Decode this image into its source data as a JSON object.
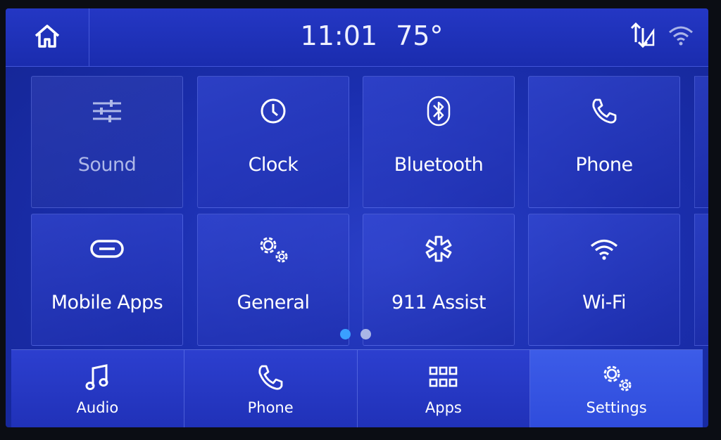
{
  "status_bar": {
    "time": "11:01",
    "temperature": "75°",
    "icons": [
      "home-icon",
      "data-signal-icon",
      "wifi-icon"
    ]
  },
  "tiles": [
    {
      "label": "Sound",
      "icon": "equalizer-icon",
      "state": "dimmed"
    },
    {
      "label": "Clock",
      "icon": "clock-icon"
    },
    {
      "label": "Bluetooth",
      "icon": "bluetooth-icon"
    },
    {
      "label": "Phone",
      "icon": "phone-icon"
    },
    {
      "label": "Mobile Apps",
      "icon": "link-icon"
    },
    {
      "label": "General",
      "icon": "gears-icon"
    },
    {
      "label": "911 Assist",
      "icon": "star-of-life-icon"
    },
    {
      "label": "Wi-Fi",
      "icon": "wifi-icon"
    }
  ],
  "pagination": {
    "pages": 2,
    "current": 1
  },
  "bottom_nav": [
    {
      "label": "Audio",
      "icon": "music-note-icon"
    },
    {
      "label": "Phone",
      "icon": "phone-icon"
    },
    {
      "label": "Apps",
      "icon": "apps-grid-icon"
    },
    {
      "label": "Settings",
      "icon": "gears-icon",
      "active": true
    }
  ],
  "colors": {
    "background": "#1b2fb0",
    "active_dot": "#3aa0ff",
    "inactive_dot": "#a9b6e6",
    "active_nav": "#3150de"
  }
}
